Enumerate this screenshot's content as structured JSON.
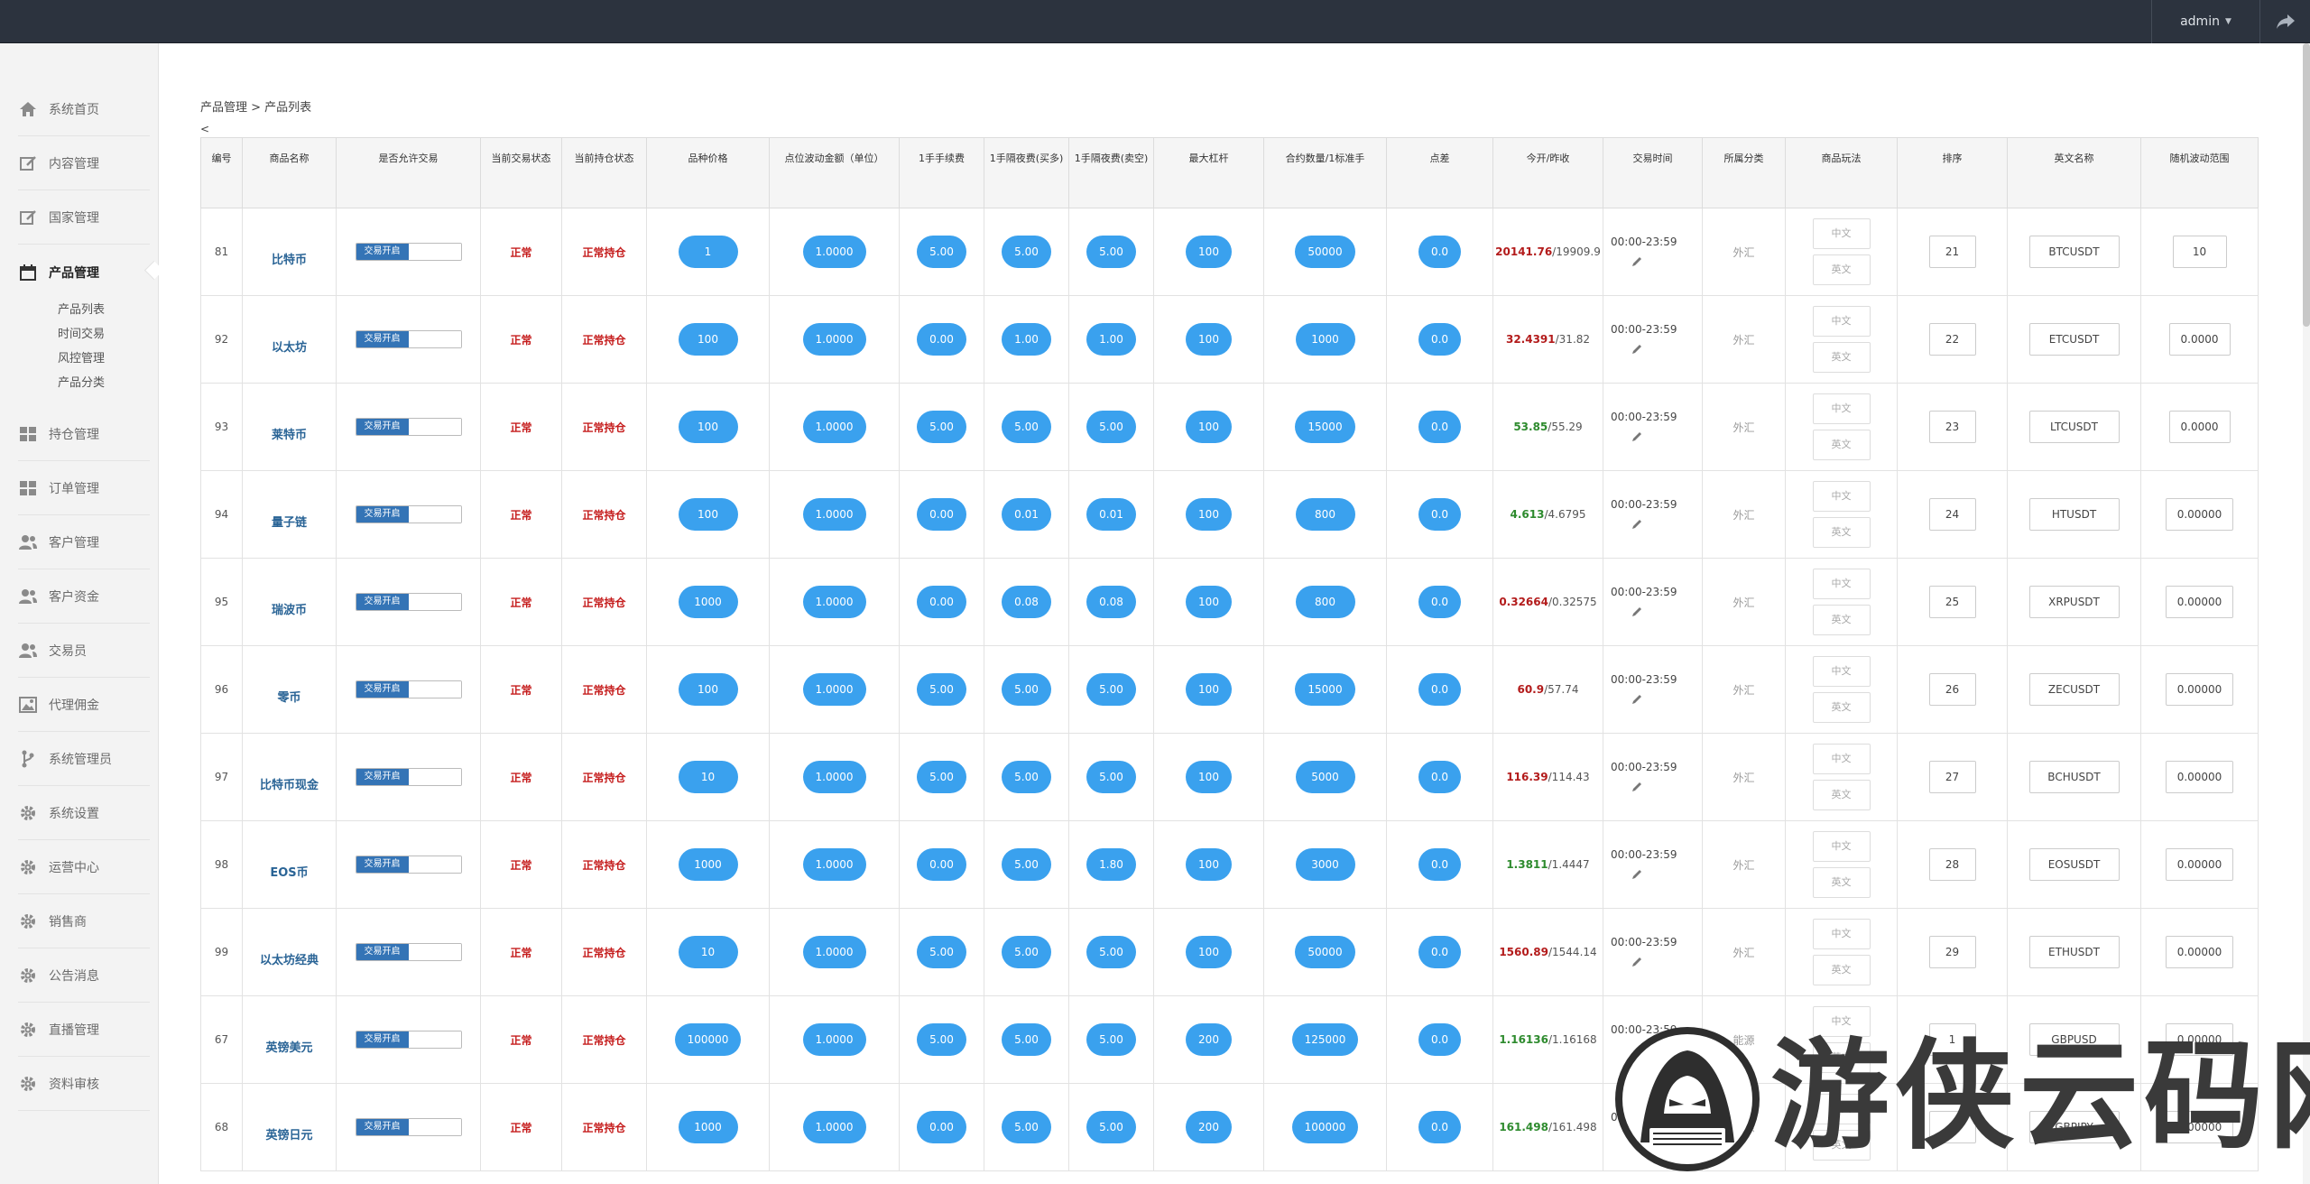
{
  "topbar": {
    "user": "admin"
  },
  "sidebar": {
    "items": [
      {
        "label": "系统首页",
        "icon": "home-icon"
      },
      {
        "label": "内容管理",
        "icon": "edit-icon"
      },
      {
        "label": "国家管理",
        "icon": "edit-icon"
      },
      {
        "label": "产品管理",
        "icon": "calendar-icon",
        "active": true
      },
      {
        "label": "持仓管理",
        "icon": "grid-icon"
      },
      {
        "label": "订单管理",
        "icon": "grid-icon"
      },
      {
        "label": "客户管理",
        "icon": "users-icon"
      },
      {
        "label": "客户资金",
        "icon": "users-icon"
      },
      {
        "label": "交易员",
        "icon": "users-icon"
      },
      {
        "label": "代理佣金",
        "icon": "image-icon"
      },
      {
        "label": "系统管理员",
        "icon": "branch-icon"
      },
      {
        "label": "系统设置",
        "icon": "gear-icon"
      },
      {
        "label": "运营中心",
        "icon": "gear-icon"
      },
      {
        "label": "销售商",
        "icon": "gear-icon"
      },
      {
        "label": "公告消息",
        "icon": "gear-icon"
      },
      {
        "label": "直播管理",
        "icon": "gear-icon"
      },
      {
        "label": "资料审核",
        "icon": "gear-icon"
      }
    ],
    "sub_items": [
      "产品列表",
      "时间交易",
      "风控管理",
      "产品分类"
    ]
  },
  "breadcrumb": "产品管理 > 产品列表",
  "back": "<",
  "table": {
    "headers": [
      "编号",
      "商品名称",
      "是否允许交易",
      "当前交易状态",
      "当前持仓状态",
      "品种价格",
      "点位波动金额（单位）",
      "1手手续费",
      "1手隔夜费(买多)",
      "1手隔夜费(卖空)",
      "最大杠杆",
      "合约数量/1标准手",
      "点差",
      "今开/昨收",
      "交易时间",
      "所属分类",
      "商品玩法",
      "排序",
      "英文名称",
      "随机波动范围"
    ],
    "switch_label": "交易开启",
    "play_cn": "中文",
    "play_en": "英文",
    "rows": [
      {
        "id": "81",
        "name": "比特币",
        "trade": "正常",
        "hold": "正常持仓",
        "price": "1",
        "point": "1.0000",
        "fee": "5.00",
        "buy": "5.00",
        "sell": "5.00",
        "lev": "100",
        "qty": "50000",
        "spread": "0.0",
        "open": "20141.76",
        "prev": "/19909.9",
        "dir": "up",
        "time": "00:00-23:59",
        "cat": "外汇",
        "sort": "21",
        "en": "BTCUSDT",
        "rnd": "10"
      },
      {
        "id": "92",
        "name": "以太坊",
        "trade": "正常",
        "hold": "正常持仓",
        "price": "100",
        "point": "1.0000",
        "fee": "0.00",
        "buy": "1.00",
        "sell": "1.00",
        "lev": "100",
        "qty": "1000",
        "spread": "0.0",
        "open": "32.4391",
        "prev": "/31.82",
        "dir": "up",
        "time": "00:00-23:59",
        "cat": "外汇",
        "sort": "22",
        "en": "ETCUSDT",
        "rnd": "0.0000"
      },
      {
        "id": "93",
        "name": "莱特币",
        "trade": "正常",
        "hold": "正常持仓",
        "price": "100",
        "point": "1.0000",
        "fee": "5.00",
        "buy": "5.00",
        "sell": "5.00",
        "lev": "100",
        "qty": "15000",
        "spread": "0.0",
        "open": "53.85",
        "prev": "/55.29",
        "dir": "dn",
        "time": "00:00-23:59",
        "cat": "外汇",
        "sort": "23",
        "en": "LTCUSDT",
        "rnd": "0.0000"
      },
      {
        "id": "94",
        "name": "量子链",
        "trade": "正常",
        "hold": "正常持仓",
        "price": "100",
        "point": "1.0000",
        "fee": "0.00",
        "buy": "0.01",
        "sell": "0.01",
        "lev": "100",
        "qty": "800",
        "spread": "0.0",
        "open": "4.613",
        "prev": "/4.6795",
        "dir": "dn",
        "time": "00:00-23:59",
        "cat": "外汇",
        "sort": "24",
        "en": "HTUSDT",
        "rnd": "0.00000"
      },
      {
        "id": "95",
        "name": "瑞波币",
        "trade": "正常",
        "hold": "正常持仓",
        "price": "1000",
        "point": "1.0000",
        "fee": "0.00",
        "buy": "0.08",
        "sell": "0.08",
        "lev": "100",
        "qty": "800",
        "spread": "0.0",
        "open": "0.32664",
        "prev": "/0.32575",
        "dir": "up",
        "time": "00:00-23:59",
        "cat": "外汇",
        "sort": "25",
        "en": "XRPUSDT",
        "rnd": "0.00000"
      },
      {
        "id": "96",
        "name": "零币",
        "trade": "正常",
        "hold": "正常持仓",
        "price": "100",
        "point": "1.0000",
        "fee": "5.00",
        "buy": "5.00",
        "sell": "5.00",
        "lev": "100",
        "qty": "15000",
        "spread": "0.0",
        "open": "60.9",
        "prev": "/57.74",
        "dir": "up",
        "time": "00:00-23:59",
        "cat": "外汇",
        "sort": "26",
        "en": "ZECUSDT",
        "rnd": "0.00000"
      },
      {
        "id": "97",
        "name": "比特币现金",
        "trade": "正常",
        "hold": "正常持仓",
        "price": "10",
        "point": "1.0000",
        "fee": "5.00",
        "buy": "5.00",
        "sell": "5.00",
        "lev": "100",
        "qty": "5000",
        "spread": "0.0",
        "open": "116.39",
        "prev": "/114.43",
        "dir": "up",
        "time": "00:00-23:59",
        "cat": "外汇",
        "sort": "27",
        "en": "BCHUSDT",
        "rnd": "0.00000"
      },
      {
        "id": "98",
        "name": "EOS币",
        "trade": "正常",
        "hold": "正常持仓",
        "price": "1000",
        "point": "1.0000",
        "fee": "0.00",
        "buy": "5.00",
        "sell": "1.80",
        "lev": "100",
        "qty": "3000",
        "spread": "0.0",
        "open": "1.3811",
        "prev": "/1.4447",
        "dir": "dn",
        "time": "00:00-23:59",
        "cat": "外汇",
        "sort": "28",
        "en": "EOSUSDT",
        "rnd": "0.00000"
      },
      {
        "id": "99",
        "name": "以太坊经典",
        "trade": "正常",
        "hold": "正常持仓",
        "price": "10",
        "point": "1.0000",
        "fee": "5.00",
        "buy": "5.00",
        "sell": "5.00",
        "lev": "100",
        "qty": "50000",
        "spread": "0.0",
        "open": "1560.89",
        "prev": "/1544.14",
        "dir": "up",
        "time": "00:00-23:59",
        "cat": "外汇",
        "sort": "29",
        "en": "ETHUSDT",
        "rnd": "0.00000"
      },
      {
        "id": "67",
        "name": "英镑美元",
        "trade": "正常",
        "hold": "正常持仓",
        "price": "100000",
        "point": "1.0000",
        "fee": "5.00",
        "buy": "5.00",
        "sell": "5.00",
        "lev": "200",
        "qty": "125000",
        "spread": "0.0",
        "open": "1.16136",
        "prev": "/1.16168",
        "dir": "dn",
        "time": "00:00-23:59",
        "cat": "能源",
        "sort": "1",
        "en": "GBPUSD",
        "rnd": "0.00000"
      },
      {
        "id": "68",
        "name": "英镑日元",
        "trade": "正常",
        "hold": "正常持仓",
        "price": "1000",
        "point": "1.0000",
        "fee": "0.00",
        "buy": "5.00",
        "sell": "5.00",
        "lev": "200",
        "qty": "100000",
        "spread": "0.0",
        "open": "161.498",
        "prev": "/161.498",
        "dir": "dn",
        "time": "00:00-23:59",
        "cat": "能源",
        "sort": "2",
        "en": "GBPJPY",
        "rnd": "0.00000"
      }
    ]
  },
  "watermark": "游侠云码网"
}
